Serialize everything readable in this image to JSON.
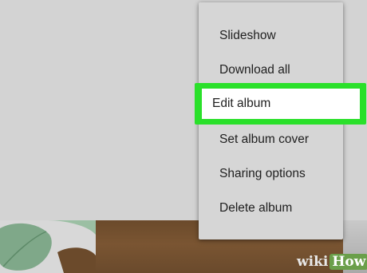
{
  "menu": {
    "items": [
      {
        "label": "Slideshow"
      },
      {
        "label": "Download all"
      },
      {
        "label": "Edit album",
        "highlighted": true
      },
      {
        "label": "Set album cover"
      },
      {
        "label": "Sharing options"
      },
      {
        "label": "Delete album"
      }
    ]
  },
  "colors": {
    "highlight": "#2ae02a",
    "menu_background": "#d6d6d6",
    "page_background": "#d3d3d3"
  },
  "watermark": {
    "part1": "wiki",
    "part2": "How"
  }
}
